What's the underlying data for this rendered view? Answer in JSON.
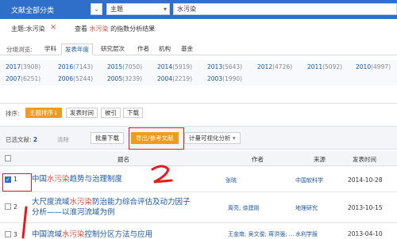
{
  "search": {
    "category_label": "文献全部分类",
    "field": "主题",
    "query": "水污染"
  },
  "filter": {
    "tag_text": "主题:水污染",
    "remove_symbol": "×",
    "view_prefix": "查看 ",
    "view_highlight": "水污染",
    "view_suffix": " 的指数分析结果"
  },
  "grouping": {
    "label": "分组浏览:",
    "tabs": [
      "学科",
      "发表年度",
      "研究层次",
      "作者",
      "机构",
      "基金"
    ],
    "active_tab": "发表年度"
  },
  "years": [
    {
      "year": "2017",
      "count": "(3908)"
    },
    {
      "year": "2016",
      "count": "(7143)"
    },
    {
      "year": "2015",
      "count": "(7050)"
    },
    {
      "year": "2014",
      "count": "(5919)"
    },
    {
      "year": "2013",
      "count": "(5643)"
    },
    {
      "year": "2012",
      "count": "(4726)"
    },
    {
      "year": "2011",
      "count": "(5092)"
    },
    {
      "year": "2010",
      "count": "(4997)"
    },
    {
      "year": "2007",
      "count": "(6251)"
    },
    {
      "year": "2006",
      "count": "(5244)"
    },
    {
      "year": "2005",
      "count": "(3239)"
    },
    {
      "year": "2004",
      "count": "(2219)"
    },
    {
      "year": "2003",
      "count": "(1990)"
    },
    {
      "year": "",
      "count": ""
    }
  ],
  "sort": {
    "label": "排序:",
    "options": [
      "主题排序↓",
      "发表时间",
      "被引",
      "下载"
    ]
  },
  "toolbar": {
    "selected_label": "已选文献:",
    "selected_count": "2",
    "clear": "清除",
    "batch_download": "批量下载",
    "export": "导出/参考文献",
    "visual_analysis": "计量可视化分析",
    "caret": "▾"
  },
  "table": {
    "headers": {
      "title": "题名",
      "author": "作者",
      "source": "来源",
      "date": "发表时间"
    },
    "rows": [
      {
        "num": "1",
        "checked": true,
        "title_pre": "中国",
        "title_hl": "水污染",
        "title_post": "趋势与治理制度",
        "title_line2": "",
        "author": "张晓",
        "source": "中国软科学",
        "date": "2014-10-28"
      },
      {
        "num": "2",
        "checked": false,
        "title_pre": "大尺度流域",
        "title_hl": "水污染",
        "title_post": "防治能力综合评估及动力因子",
        "title_line2": "分析——以淮河流域为例",
        "author": "周亮; 徐建刚",
        "source": "地理研究",
        "date": "2013-10-15"
      },
      {
        "num": "3",
        "checked": false,
        "title_pre": "中国流域",
        "title_hl": "水污染",
        "title_post": "控制分区方法与应用",
        "title_line2": "",
        "author": "王金南; 吴文俊; 蒋洪强; ...",
        "source": "水利学报",
        "date": "2013-04-10"
      }
    ]
  },
  "annotations": {
    "number_two": "2",
    "number_one": "1"
  },
  "colors": {
    "topbar": "#2f6fc9",
    "link": "#1a56a8",
    "highlight": "#e04b3b",
    "orange": "#f39a1c",
    "mark_red": "#e21b1b"
  }
}
